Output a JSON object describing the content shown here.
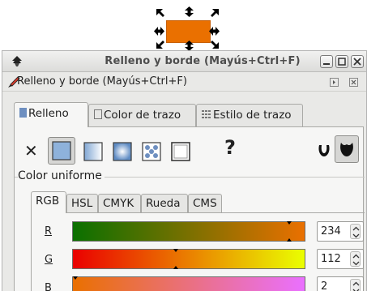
{
  "window": {
    "title": "Relleno y borde (Mayús+Ctrl+F)",
    "dock_title": "Relleno y borde (Mayús+Ctrl+F)"
  },
  "canvas": {
    "object_fill": "#ea7000"
  },
  "main_tabs": [
    {
      "label": "Relleno",
      "active": true
    },
    {
      "label": "Color de trazo",
      "active": false
    },
    {
      "label": "Estilo de trazo",
      "active": false
    }
  ],
  "fill_types": {
    "unknown": "?",
    "selected": "flat-color"
  },
  "section": {
    "flat_color_label": "Color uniforme"
  },
  "color_tabs": [
    {
      "label": "RGB",
      "active": true
    },
    {
      "label": "HSL",
      "active": false
    },
    {
      "label": "CMYK",
      "active": false
    },
    {
      "label": "Rueda",
      "active": false
    },
    {
      "label": "CMS",
      "active": false
    }
  ],
  "sliders": [
    {
      "label": "R",
      "value": "234"
    },
    {
      "label": "G",
      "value": "112"
    },
    {
      "label": "B",
      "value": "2"
    }
  ]
}
